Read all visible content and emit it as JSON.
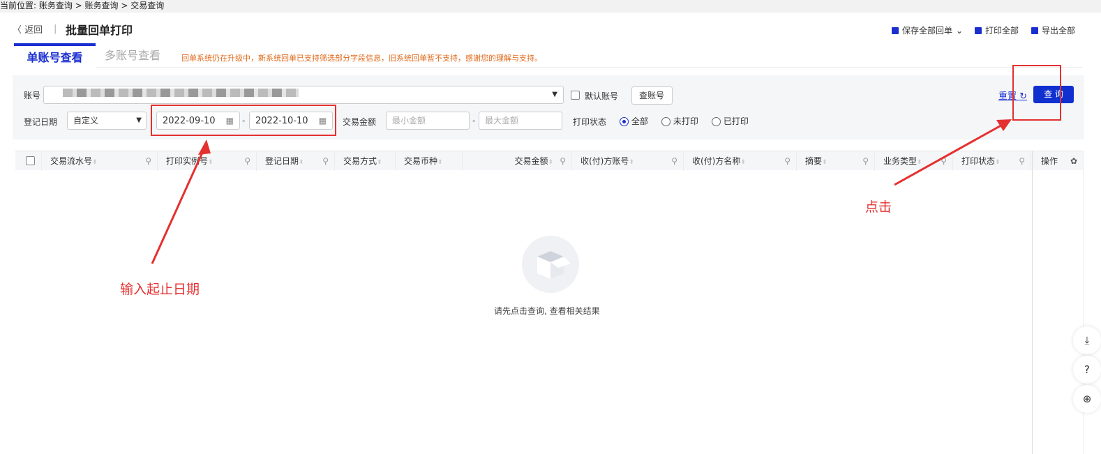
{
  "breadcrumb": "当前位置: 账务查询 > 账务查询 > 交易查询",
  "header": {
    "back": "返回",
    "title": "批量回单打印",
    "actions": [
      {
        "label": "保存全部回单",
        "icon": "save-icon"
      },
      {
        "label": "打印全部",
        "icon": "printer-icon"
      },
      {
        "label": "导出全部",
        "icon": "export-icon"
      }
    ]
  },
  "tabs": [
    {
      "label": "单账号查看",
      "active": true
    },
    {
      "label": "多账号查看",
      "active": false
    }
  ],
  "notice": "回单系统仍在升级中，新系统回单已支持筛选部分字段信息，旧系统回单暂不支持，感谢您的理解与支持。",
  "filter": {
    "account_label": "账号",
    "default_account": "默认账号",
    "lookup": "查账号",
    "date_label": "登记日期",
    "date_mode": "自定义",
    "date_start": "2022-09-10",
    "date_end": "2022-10-10",
    "amount_label": "交易金额",
    "min_ph": "最小金额",
    "max_ph": "最大金额",
    "print_label": "打印状态",
    "print_options": [
      "全部",
      "未打印",
      "已打印"
    ],
    "print_selected": "全部",
    "reset": "重置",
    "query": "查 询"
  },
  "table": {
    "columns": [
      "交易流水号",
      "打印实例号",
      "登记日期",
      "交易方式",
      "交易币种",
      "交易金额",
      "收(付)方账号",
      "收(付)方名称",
      "摘要",
      "业务类型",
      "打印状态",
      "操作"
    ],
    "empty": "请先点击查询, 查看相关结果"
  },
  "annotations": {
    "date_hint": "输入起止日期",
    "click_hint": "点击"
  },
  "colors": {
    "primary": "#1130d0",
    "annotation": "#e53030",
    "notice": "#e06a1b"
  }
}
